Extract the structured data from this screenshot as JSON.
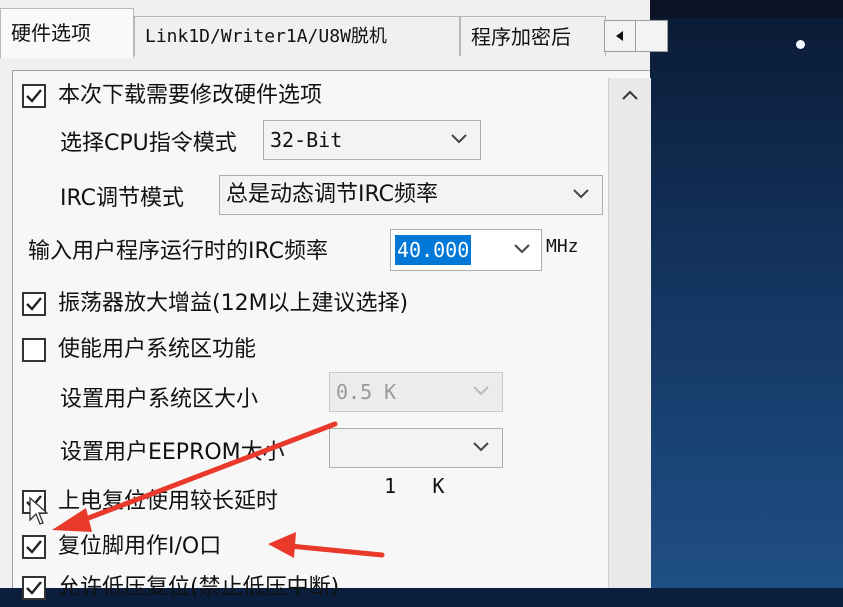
{
  "tabs": [
    {
      "label": "硬件选项"
    },
    {
      "label": "Link1D/Writer1A/U8W脱机"
    },
    {
      "label": "程序加密后"
    }
  ],
  "options": {
    "modify_hw": {
      "label": "本次下载需要修改硬件选项",
      "checked": true
    },
    "cpu_mode": {
      "label": "选择CPU指令模式",
      "value": "32-Bit"
    },
    "irc_mode": {
      "label": "IRC调节模式",
      "value": "总是动态调节IRC频率"
    },
    "irc_freq": {
      "label": "输入用户程序运行时的IRC频率",
      "value": "40.000",
      "unit": "MHz"
    },
    "osc_gain": {
      "label": "振荡器放大增益(12M以上建议选择)",
      "checked": true
    },
    "user_sys_area": {
      "label": "使能用户系统区功能",
      "checked": false
    },
    "user_sys_size": {
      "label": "设置用户系统区大小",
      "value": "0.5 K",
      "enabled": false
    },
    "eeprom_size": {
      "label": "设置用户EEPROM大小",
      "value": "1   K"
    },
    "long_reset_delay": {
      "label": "上电复位使用较长延时",
      "checked": true
    },
    "reset_pin_io": {
      "label": "复位脚用作I/O口",
      "checked": true
    },
    "low_voltage_reset": {
      "label": "允许低压复位(禁止低压中断)",
      "checked": true
    }
  },
  "colors": {
    "selection": "#0078d7",
    "annotation_arrow": "#e8392b"
  }
}
